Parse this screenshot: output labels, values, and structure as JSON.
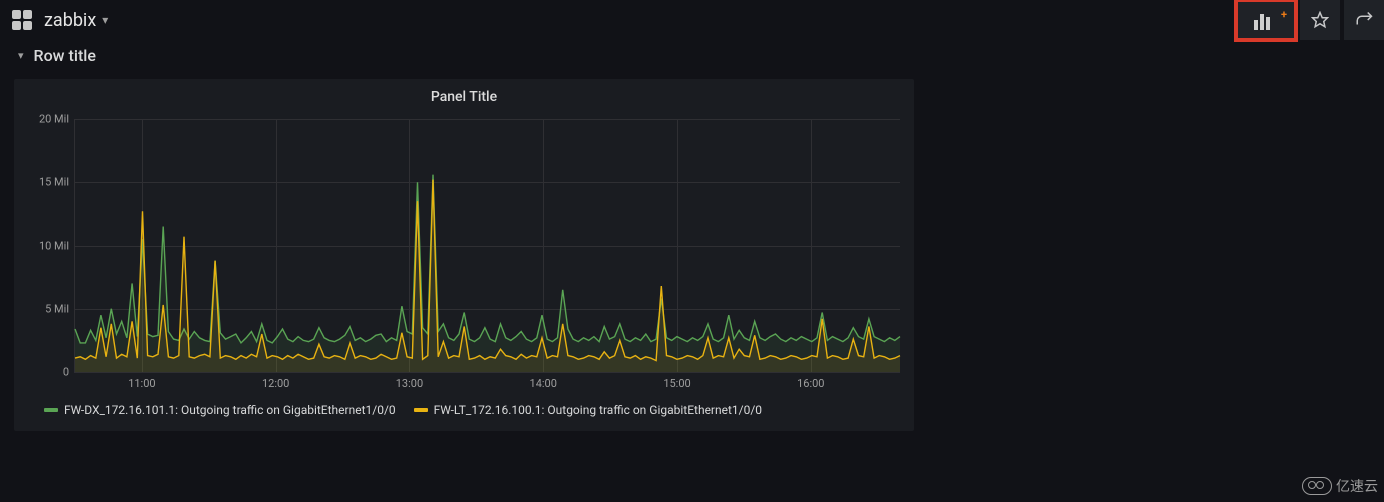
{
  "header": {
    "dashboard_title": "zabbix"
  },
  "row": {
    "title": "Row title"
  },
  "panel": {
    "title": "Panel Title"
  },
  "legend": {
    "s1": "FW-DX_172.16.101.1: Outgoing traffic on GigabitEthernet1/0/0",
    "s2": "FW-LT_172.16.100.1: Outgoing traffic on GigabitEthernet1/0/0"
  },
  "watermark": "亿速云",
  "chart_data": {
    "type": "line",
    "xlabel": "",
    "ylabel": "",
    "ylim": [
      0,
      20000000
    ],
    "y_ticks": [
      {
        "label": "0",
        "value": 0
      },
      {
        "label": "5 Mil",
        "value": 5000000
      },
      {
        "label": "10 Mil",
        "value": 10000000
      },
      {
        "label": "15 Mil",
        "value": 15000000
      },
      {
        "label": "20 Mil",
        "value": 20000000
      }
    ],
    "x_range": [
      "10:30",
      "16:40"
    ],
    "x_ticks": [
      "11:00",
      "12:00",
      "13:00",
      "14:00",
      "15:00",
      "16:00"
    ],
    "series": [
      {
        "name": "FW-DX_172.16.101.1: Outgoing traffic on GigabitEthernet1/0/0",
        "color": "#5aa454",
        "values": [
          3.4,
          2.3,
          2.3,
          3.3,
          2.5,
          4.5,
          2.7,
          5.0,
          3.0,
          4.0,
          2.7,
          7.0,
          2.8,
          10.5,
          3.0,
          2.8,
          2.9,
          11.5,
          3.2,
          2.6,
          2.5,
          3.4,
          2.6,
          3.2,
          2.7,
          2.5,
          2.4,
          8.8,
          3.1,
          2.6,
          2.8,
          3.0,
          2.3,
          2.7,
          3.2,
          2.4,
          3.8,
          2.5,
          2.3,
          2.8,
          3.4,
          2.6,
          2.4,
          2.8,
          2.5,
          2.4,
          2.6,
          3.5,
          2.7,
          2.5,
          2.4,
          2.6,
          2.9,
          3.6,
          2.5,
          2.7,
          2.4,
          2.6,
          2.9,
          3.0,
          2.4,
          2.7,
          2.5,
          5.2,
          3.2,
          3.0,
          15.0,
          3.5,
          3.0,
          15.6,
          3.2,
          3.8,
          2.7,
          2.5,
          3.0,
          4.7,
          2.6,
          2.4,
          2.7,
          3.5,
          2.6,
          2.4,
          3.8,
          2.7,
          2.5,
          2.8,
          3.2,
          2.6,
          2.4,
          2.7,
          4.5,
          2.6,
          2.4,
          2.7,
          6.5,
          3.4,
          2.6,
          2.4,
          2.7,
          2.5,
          2.8,
          2.4,
          3.6,
          2.6,
          2.8,
          3.8,
          2.6,
          2.4,
          2.7,
          2.5,
          3.0,
          2.4,
          2.6,
          5.8,
          2.7,
          2.5,
          2.8,
          2.6,
          2.4,
          2.7,
          2.5,
          2.8,
          3.8,
          2.6,
          2.4,
          2.7,
          4.5,
          2.6,
          3.3,
          2.7,
          2.5,
          4.0,
          2.7,
          2.5,
          2.8,
          3.0,
          2.6,
          2.4,
          2.7,
          2.5,
          2.8,
          2.6,
          2.4,
          2.7,
          4.7,
          2.5,
          2.8,
          2.6,
          2.4,
          2.7,
          3.5,
          2.8,
          2.6,
          4.2,
          2.8,
          2.6,
          2.4,
          2.7,
          2.5,
          2.8
        ]
      },
      {
        "name": "FW-LT_172.16.100.1: Outgoing traffic on GigabitEthernet1/0/0",
        "color": "#e8b312",
        "values": [
          1.1,
          1.2,
          1.0,
          1.3,
          1.1,
          3.5,
          1.2,
          3.8,
          1.1,
          1.4,
          1.2,
          4.0,
          1.1,
          12.7,
          1.3,
          1.2,
          1.4,
          5.3,
          1.2,
          1.1,
          1.3,
          10.7,
          1.2,
          1.1,
          1.3,
          1.4,
          1.2,
          8.8,
          1.1,
          1.3,
          1.2,
          1.0,
          1.3,
          1.1,
          1.4,
          1.2,
          3.0,
          1.1,
          1.3,
          1.2,
          1.0,
          1.3,
          1.1,
          1.4,
          1.2,
          1.0,
          1.1,
          2.2,
          1.2,
          1.1,
          1.3,
          1.2,
          1.0,
          2.3,
          1.1,
          1.3,
          1.2,
          1.0,
          1.1,
          1.4,
          1.2,
          1.0,
          1.1,
          3.1,
          1.2,
          1.1,
          13.5,
          1.0,
          1.3,
          15.2,
          1.2,
          2.4,
          1.1,
          1.3,
          1.2,
          3.6,
          1.0,
          1.1,
          1.3,
          1.0,
          1.2,
          1.1,
          1.8,
          1.3,
          1.2,
          1.0,
          1.4,
          1.1,
          1.3,
          1.2,
          2.7,
          1.1,
          1.3,
          1.2,
          3.8,
          1.3,
          1.2,
          1.0,
          1.1,
          1.3,
          1.2,
          1.0,
          1.6,
          1.1,
          1.3,
          2.5,
          1.2,
          1.1,
          1.3,
          1.0,
          1.2,
          1.1,
          0.9,
          6.8,
          1.3,
          1.2,
          1.0,
          1.1,
          1.3,
          1.2,
          1.0,
          1.3,
          2.7,
          1.1,
          1.3,
          1.2,
          2.7,
          1.1,
          1.8,
          1.3,
          1.2,
          2.9,
          1.0,
          1.1,
          1.3,
          1.2,
          1.0,
          1.1,
          1.3,
          1.2,
          1.0,
          1.1,
          1.3,
          1.2,
          4.2,
          1.1,
          1.3,
          1.2,
          1.0,
          1.1,
          2.6,
          1.3,
          1.2,
          3.6,
          1.1,
          1.3,
          1.2,
          1.0,
          1.1,
          1.3
        ]
      }
    ]
  }
}
